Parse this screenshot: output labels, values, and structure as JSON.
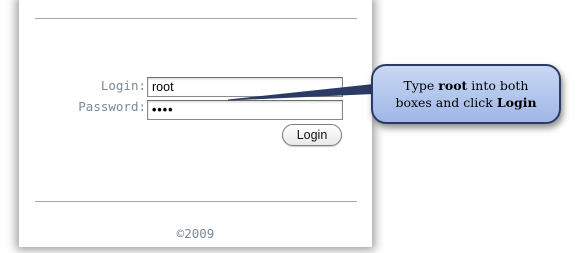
{
  "form": {
    "login_label": "Login:",
    "password_label": "Password:",
    "login_value": "root",
    "password_masked": "••••",
    "login_button": "Login"
  },
  "footer": {
    "copyright": "©2009"
  },
  "callout": {
    "line1_prefix": "Type ",
    "line1_bold": "root",
    "line1_suffix": " into both",
    "line2_prefix": "boxes and click ",
    "line2_bold": "Login"
  },
  "colors": {
    "callout_fill": "#b6c9ee",
    "callout_border": "#2b3b66",
    "label_text": "#7a8a98"
  }
}
